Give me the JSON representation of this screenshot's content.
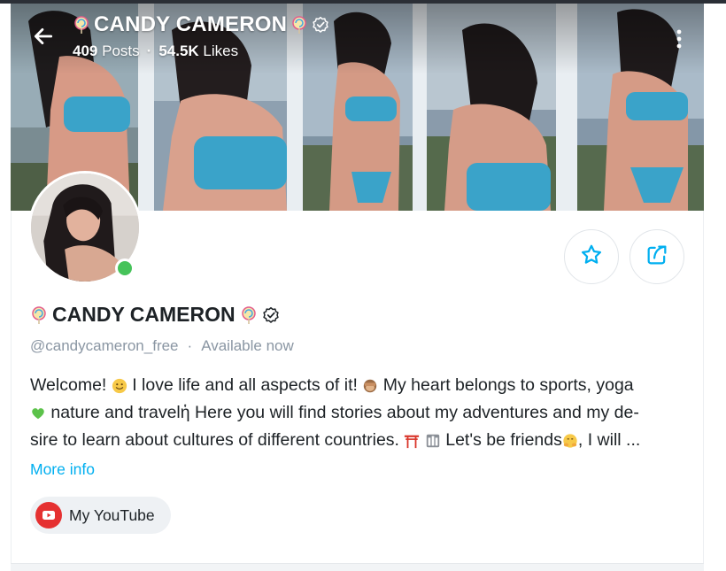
{
  "header": {
    "title": "CANDY CAMERON",
    "posts_count": "409",
    "posts_label": "Posts",
    "separator": "·",
    "likes_count": "54.5K",
    "likes_label": "Likes"
  },
  "profile": {
    "name": "CANDY CAMERON",
    "handle": "@candycameron_free",
    "separator": "·",
    "status": "Available now",
    "online": true,
    "bio_lines": [
      "I love life and all aspects of it!",
      "My heart belongs to sports, yoga",
      "nature and travelἡ Here you will find stories about my adventures and my de-",
      "sire to learn about cultures of different countries.",
      "Let's be friends",
      ", I will ..."
    ],
    "bio_welcome": "Welcome!",
    "more_info_label": "More info"
  },
  "links": [
    {
      "label": "My YouTube",
      "icon": "youtube-icon"
    }
  ],
  "actions": {
    "favorite_icon": "star-icon",
    "share_icon": "share-icon"
  },
  "colors": {
    "accent": "#00aff0",
    "online": "#46c35a",
    "youtube": "#e53131",
    "text": "#1d2226",
    "muted": "#8a96a3"
  }
}
